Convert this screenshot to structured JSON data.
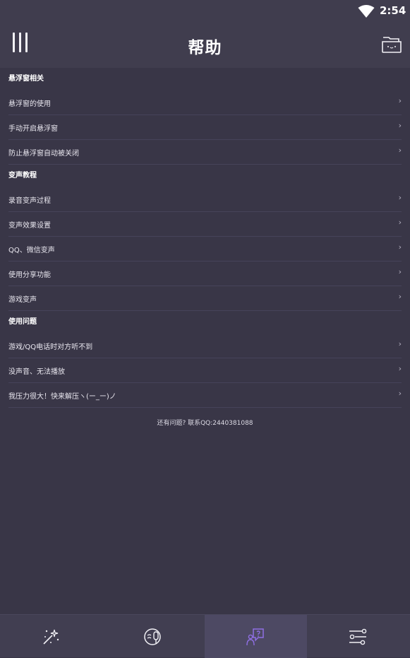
{
  "status_bar": {
    "time": "2:54"
  },
  "app_bar": {
    "title": "帮助"
  },
  "sections": [
    {
      "header": "悬浮窗相关",
      "items": [
        {
          "label": "悬浮窗的使用",
          "chevron": "›"
        },
        {
          "label": "手动开启悬浮窗",
          "chevron": "›"
        },
        {
          "label": "防止悬浮窗自动被关闭",
          "chevron": "›"
        }
      ]
    },
    {
      "header": "变声教程",
      "items": [
        {
          "label": "录音变声过程",
          "chevron": "›"
        },
        {
          "label": "变声效果设置",
          "chevron": "›"
        },
        {
          "label": "QQ、微信变声",
          "chevron": "›"
        },
        {
          "label": "使用分享功能",
          "chevron": "›"
        },
        {
          "label": "游戏变声",
          "chevron": "›"
        }
      ]
    },
    {
      "header": "使用问题",
      "items": [
        {
          "label": "游戏/QQ电话时对方听不到",
          "chevron": "›"
        },
        {
          "label": "没声音、无法播放",
          "chevron": "›"
        },
        {
          "label": "我压力很大！快来解压ヽ(ー_ー)ノ",
          "chevron": "›"
        }
      ]
    }
  ],
  "footer_note": "还有问题? 联系QQ:2440381088",
  "bottom_nav": {
    "items": [
      {
        "icon": "magic-wand-icon"
      },
      {
        "icon": "voice-mic-icon"
      },
      {
        "icon": "help-chat-icon",
        "active": true
      },
      {
        "icon": "settings-sliders-icon"
      }
    ]
  },
  "colors": {
    "background": "#393647",
    "app_bar": "#403d4e",
    "active_tab": "#4d4963",
    "accent": "#8f6fe3"
  }
}
